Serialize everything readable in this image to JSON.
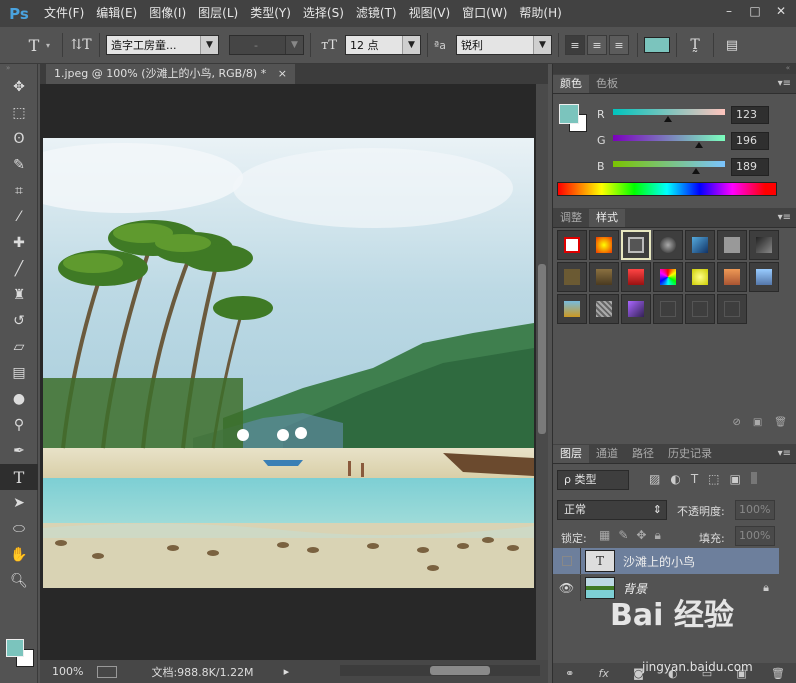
{
  "app": {
    "logo": "Ps",
    "menu": [
      "文件(F)",
      "编辑(E)",
      "图像(I)",
      "图层(L)",
      "类型(Y)",
      "选择(S)",
      "滤镜(T)",
      "视图(V)",
      "窗口(W)",
      "帮助(H)"
    ],
    "window_buttons": [
      "–",
      "□",
      "✕"
    ]
  },
  "options": {
    "font_family": "造字工房童...",
    "font_style": "-",
    "font_size": "12 点",
    "aa_label": "ªa",
    "antialias": "锐利",
    "text_color": "#7bc4bd"
  },
  "document": {
    "tab_title": "1.jpeg @ 100% (沙滩上的小鸟, RGB/8) *",
    "tab_close": "×"
  },
  "status": {
    "zoom": "100%",
    "doc_info": "文档:988.8K/1.22M"
  },
  "color_panel": {
    "tabs": [
      "颜色",
      "色板"
    ],
    "foreground": "#7bc4bd",
    "background": "#ffffff",
    "r": {
      "label": "R",
      "value": "123",
      "level": 0.48
    },
    "g": {
      "label": "G",
      "value": "196",
      "level": 0.77
    },
    "b": {
      "label": "B",
      "value": "189",
      "level": 0.74
    }
  },
  "styles_panel": {
    "tabs": [
      "调整",
      "样式"
    ]
  },
  "layers_panel": {
    "tabs": [
      "图层",
      "通道",
      "路径",
      "历史记录"
    ],
    "filter_label": "ρ 类型",
    "blend_mode": "正常",
    "opacity_label": "不透明度:",
    "opacity_value": "100%",
    "lock_label": "锁定:",
    "fill_label": "填充:",
    "fill_value": "100%",
    "layers": [
      {
        "name": "沙滩上的小鸟",
        "type": "text",
        "visible": false,
        "selected": true
      },
      {
        "name": "背景",
        "type": "image",
        "visible": true,
        "selected": false
      }
    ],
    "footer_icons": [
      "link-icon",
      "fx-icon",
      "mask-icon",
      "adjustment-icon",
      "folder-icon",
      "new-layer-icon",
      "trash-icon"
    ],
    "fx_label": "fx"
  },
  "watermark": {
    "brand": "Bai 经验",
    "url": "jingyan.baidu.com"
  }
}
